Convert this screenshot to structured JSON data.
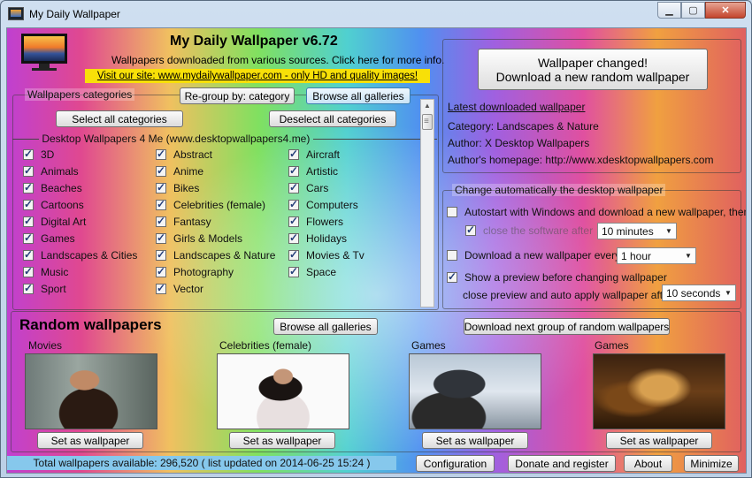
{
  "window": {
    "title": "My Daily Wallpaper"
  },
  "header": {
    "title": "My Daily Wallpaper v6.72",
    "subtitle": "Wallpapers downloaded from various sources. Click here for more info.",
    "promo_link": "Visit our site: www.mydailywallpaper.com - only HD and quality images!"
  },
  "categories": {
    "legend": "Wallpapers categories",
    "regroup_label": "Re-group by: category",
    "browse_all_label": "Browse all galleries",
    "select_all_label": "Select all categories",
    "deselect_all_label": "Deselect all categories",
    "source_name": "Desktop Wallpapers 4 Me (www.desktopwallpapers4.me)",
    "columns": [
      [
        {
          "label": "3D",
          "checked": true
        },
        {
          "label": "Animals",
          "checked": true
        },
        {
          "label": "Beaches",
          "checked": true
        },
        {
          "label": "Cartoons",
          "checked": true
        },
        {
          "label": "Digital Art",
          "checked": true
        },
        {
          "label": "Games",
          "checked": true
        },
        {
          "label": "Landscapes & Cities",
          "checked": true
        },
        {
          "label": "Music",
          "checked": true
        },
        {
          "label": "Sport",
          "checked": true
        }
      ],
      [
        {
          "label": "Abstract",
          "checked": true
        },
        {
          "label": "Anime",
          "checked": true
        },
        {
          "label": "Bikes",
          "checked": true
        },
        {
          "label": "Celebrities (female)",
          "checked": true
        },
        {
          "label": "Fantasy",
          "checked": true
        },
        {
          "label": "Girls & Models",
          "checked": true
        },
        {
          "label": "Landscapes & Nature",
          "checked": true
        },
        {
          "label": "Photography",
          "checked": true
        },
        {
          "label": "Vector",
          "checked": true
        }
      ],
      [
        {
          "label": "Aircraft",
          "checked": true
        },
        {
          "label": "Artistic",
          "checked": true
        },
        {
          "label": "Cars",
          "checked": true
        },
        {
          "label": "Computers",
          "checked": true
        },
        {
          "label": "Flowers",
          "checked": true
        },
        {
          "label": "Holidays",
          "checked": true
        },
        {
          "label": "Movies & Tv",
          "checked": true
        },
        {
          "label": "Space",
          "checked": true
        }
      ]
    ]
  },
  "latest": {
    "changed_button_line1": "Wallpaper changed!",
    "changed_button_line2": "Download a new random wallpaper",
    "heading": "Latest downloaded wallpaper",
    "category": "Category: Landscapes & Nature",
    "author": "Author: X Desktop Wallpapers",
    "homepage": "Author's homepage: http://www.xdesktopwallpapers.com"
  },
  "auto_change": {
    "legend": "Change automatically the desktop wallpaper",
    "autostart_label": "Autostart with Windows and download a new wallpaper, then:",
    "autostart_checked": false,
    "close_software_label": "close the software after",
    "close_software_checked": true,
    "close_after_value": "10 minutes",
    "download_every_label": "Download a new wallpaper every",
    "download_every_checked": false,
    "download_every_value": "1 hour",
    "preview_label": "Show a preview before changing wallpaper",
    "preview_checked": true,
    "apply_after_label": "close preview and auto apply wallpaper after",
    "apply_after_value": "10 seconds"
  },
  "random": {
    "heading": "Random wallpapers",
    "browse_all_label": "Browse all galleries",
    "next_group_label": "Download next group of random wallpapers",
    "set_label": "Set as wallpaper",
    "items": [
      {
        "category": "Movies"
      },
      {
        "category": "Celebrities (female)"
      },
      {
        "category": "Games"
      },
      {
        "category": "Games"
      }
    ]
  },
  "footer": {
    "status": "Total wallpapers available: 296,520 ( list updated on 2014-06-25 15:24 )",
    "configuration_label": "Configuration",
    "donate_label": "Donate and register",
    "about_label": "About",
    "minimize_label": "Minimize"
  }
}
